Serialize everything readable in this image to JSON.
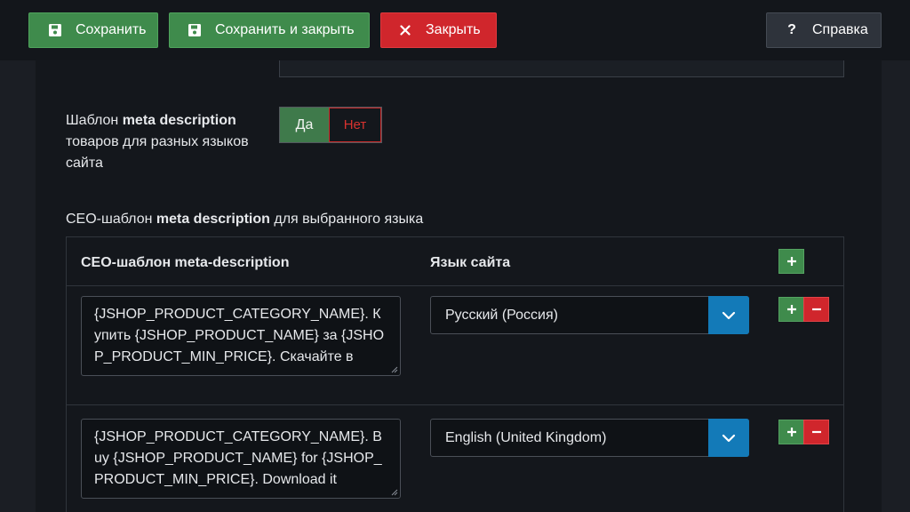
{
  "toolbar": {
    "save_label": "Сохранить",
    "save_close_label": "Сохранить и закрыть",
    "close_label": "Закрыть",
    "help_label": "Справка"
  },
  "form": {
    "partial_label": "...",
    "meta_desc_label_pre": "Шаблон ",
    "meta_desc_label_bold": "meta description",
    "meta_desc_label_post": " товаров для разных языков сайта",
    "toggle_yes": "Да",
    "toggle_no": "Нет"
  },
  "section": {
    "title_pre": "СЕО-шаблон ",
    "title_bold": "meta description",
    "title_post": " для выбранного языка"
  },
  "table": {
    "col_template": "СЕО-шаблон meta-description",
    "col_language": "Язык сайта",
    "rows": [
      {
        "template": "{JSHOP_PRODUCT_CATEGORY_NAME}. Купить {JSHOP_PRODUCT_NAME} за {JSHOP_PRODUCT_MIN_PRICE}. Скачайте в",
        "language": "Русский (Россия)"
      },
      {
        "template": "{JSHOP_PRODUCT_CATEGORY_NAME}. Buy {JSHOP_PRODUCT_NAME} for {JSHOP_PRODUCT_MIN_PRICE}. Download it",
        "language": "English (United Kingdom)"
      }
    ]
  },
  "colors": {
    "green": "#3f8b4c",
    "red": "#d0262c",
    "blue": "#137ab8",
    "background": "#1b1e24"
  },
  "icons": {
    "save": "floppy-disk-icon",
    "close": "x-icon",
    "help": "question-mark-icon",
    "add": "plus-icon",
    "remove": "minus-icon",
    "dropdown": "chevron-down-icon"
  }
}
